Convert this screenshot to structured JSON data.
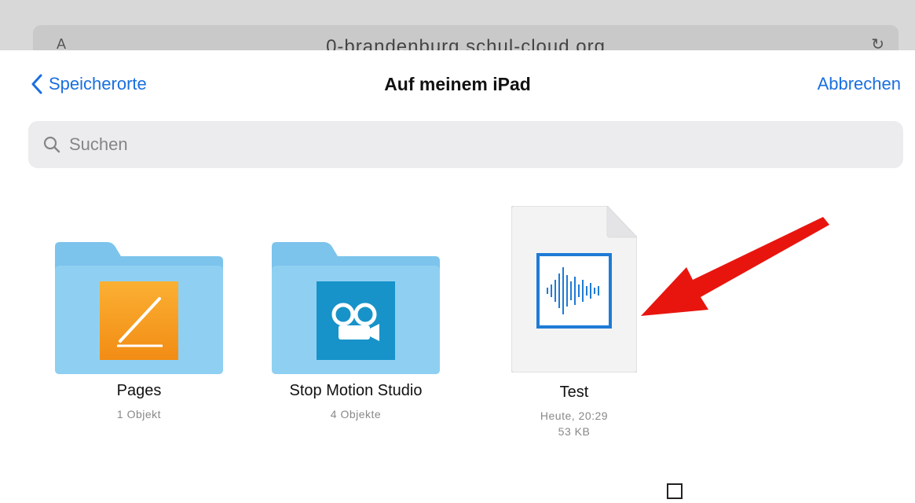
{
  "browser": {
    "url": "0-brandenburg.schul-cloud.org",
    "left_glyph": "A",
    "right_glyph": "↻"
  },
  "nav": {
    "back_label": "Speicherorte",
    "title": "Auf meinem iPad",
    "cancel_label": "Abbrechen"
  },
  "search": {
    "placeholder": "Suchen"
  },
  "items": [
    {
      "name": "Pages",
      "detail": "1 Objekt",
      "type": "folder",
      "app_icon": "pages-icon",
      "app_color": "#f7931e"
    },
    {
      "name": "Stop Motion Studio",
      "detail": "4 Objekte",
      "type": "folder",
      "app_icon": "camera-icon",
      "app_color": "#1793c9"
    },
    {
      "name": "Test",
      "date": "Heute, 20:29",
      "size": "53 KB",
      "type": "audio-file",
      "app_icon": "waveform-icon",
      "app_color": "#1f7bd6"
    }
  ],
  "colors": {
    "accent": "#1a6fe0",
    "folder": "#8fcdf0",
    "arrow": "#e8150f"
  }
}
